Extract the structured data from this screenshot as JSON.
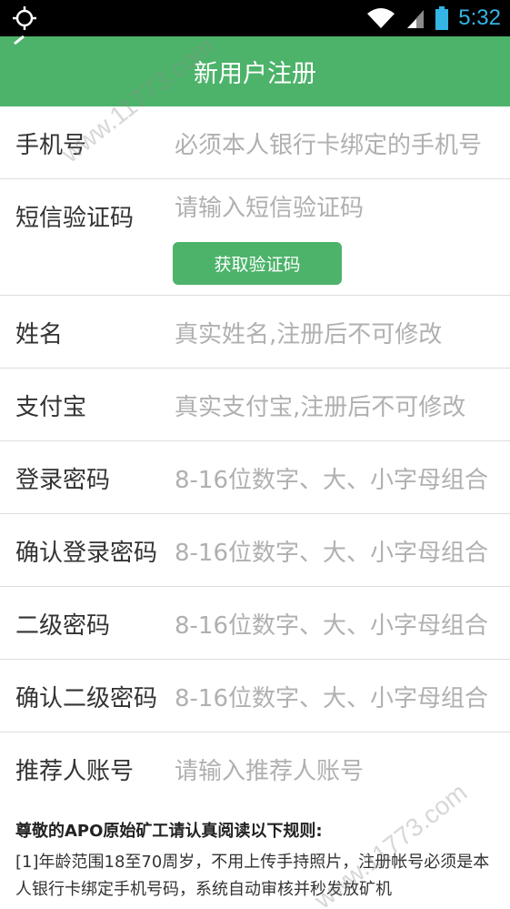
{
  "status_bar": {
    "time": "5:32",
    "left_icon": "gps-icon",
    "right_icons": [
      "wifi-icon",
      "signal-icon",
      "battery-icon"
    ]
  },
  "app_bar": {
    "title": "新用户注册",
    "back_icon": "back-icon"
  },
  "form": {
    "rows": [
      {
        "label": "手机号",
        "placeholder": "必须本人银行卡绑定的手机号"
      },
      {
        "label": "短信验证码",
        "placeholder": "请输入短信验证码"
      },
      {
        "label": "姓名",
        "placeholder": "真实姓名,注册后不可修改"
      },
      {
        "label": "支付宝",
        "placeholder": "真实支付宝,注册后不可修改"
      },
      {
        "label": "登录密码",
        "placeholder": "8-16位数字、大、小字母组合"
      },
      {
        "label": "确认登录密码",
        "placeholder": "8-16位数字、大、小字母组合"
      },
      {
        "label": "二级密码",
        "placeholder": "8-16位数字、大、小字母组合"
      },
      {
        "label": "确认二级密码",
        "placeholder": "8-16位数字、大、小字母组合"
      },
      {
        "label": "推荐人账号",
        "placeholder": "请输入推荐人账号"
      }
    ],
    "get_code_label": "获取验证码"
  },
  "rules": {
    "title": "尊敬的APO原始矿工请认真阅读以下规则:",
    "body": "[1]年龄范围18至70周岁，不用上传手持照片，注册帐号必须是本人银行卡绑定手机号码，系统自动审核并秒发放矿机"
  },
  "watermark": {
    "text": "www.11773.com"
  },
  "colors": {
    "accent": "#4db36a",
    "status_time": "#33b5e5",
    "placeholder": "#b0b0b0"
  }
}
